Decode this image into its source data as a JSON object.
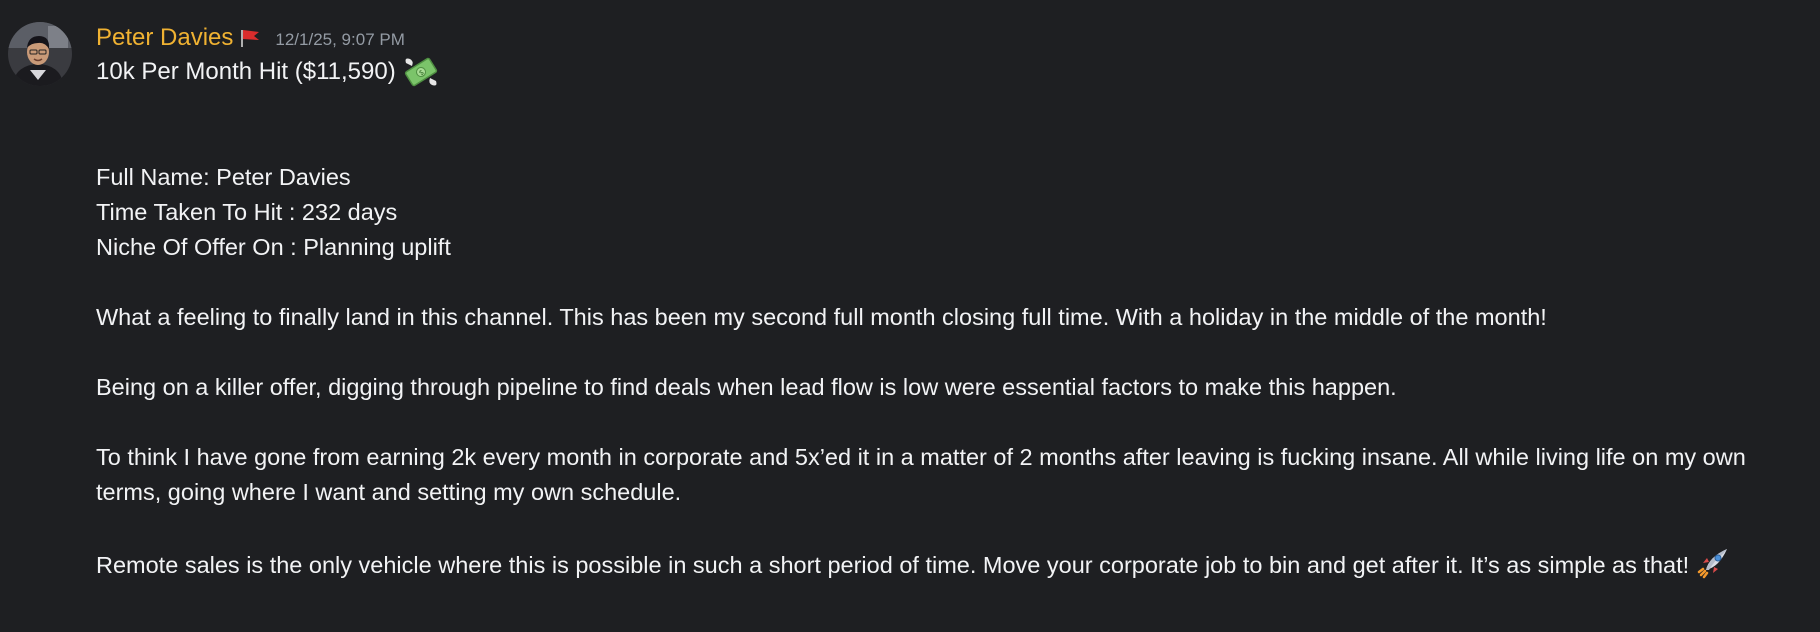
{
  "message": {
    "author": "Peter Davies",
    "timestamp": "12/1/25, 9:07 PM",
    "title": "10k Per Month Hit ($11,590)",
    "fields": [
      "Full Name: Peter Davies",
      "Time Taken To Hit :  232 days",
      "Niche Of Offer On :  Planning uplift"
    ],
    "paragraphs": [
      "What a feeling to finally land in this channel. This has been my second full month closing full time. With a holiday in the middle of the month!",
      "Being on a killer offer, digging through pipeline to find deals when lead flow is low were essential factors to make this happen.",
      "To think I have gone from earning 2k every month in corporate and 5x’ed it in a matter of 2 months after leaving is fucking insane. All while living life on my own terms, going where I want and setting my own schedule.",
      "Remote sales is the only vehicle where this is possible in such a short period of time. Move your corporate job to bin and get after it. It’s as simple as that!"
    ],
    "icons": {
      "author_badge": "red-flag-icon",
      "title_emoji": "money-with-wings-icon",
      "closing_emoji": "rocket-icon"
    }
  },
  "colors": {
    "background": "#1e1f22",
    "text": "#f2f3f5",
    "username": "#f0b232",
    "timestamp": "#949ba4"
  }
}
